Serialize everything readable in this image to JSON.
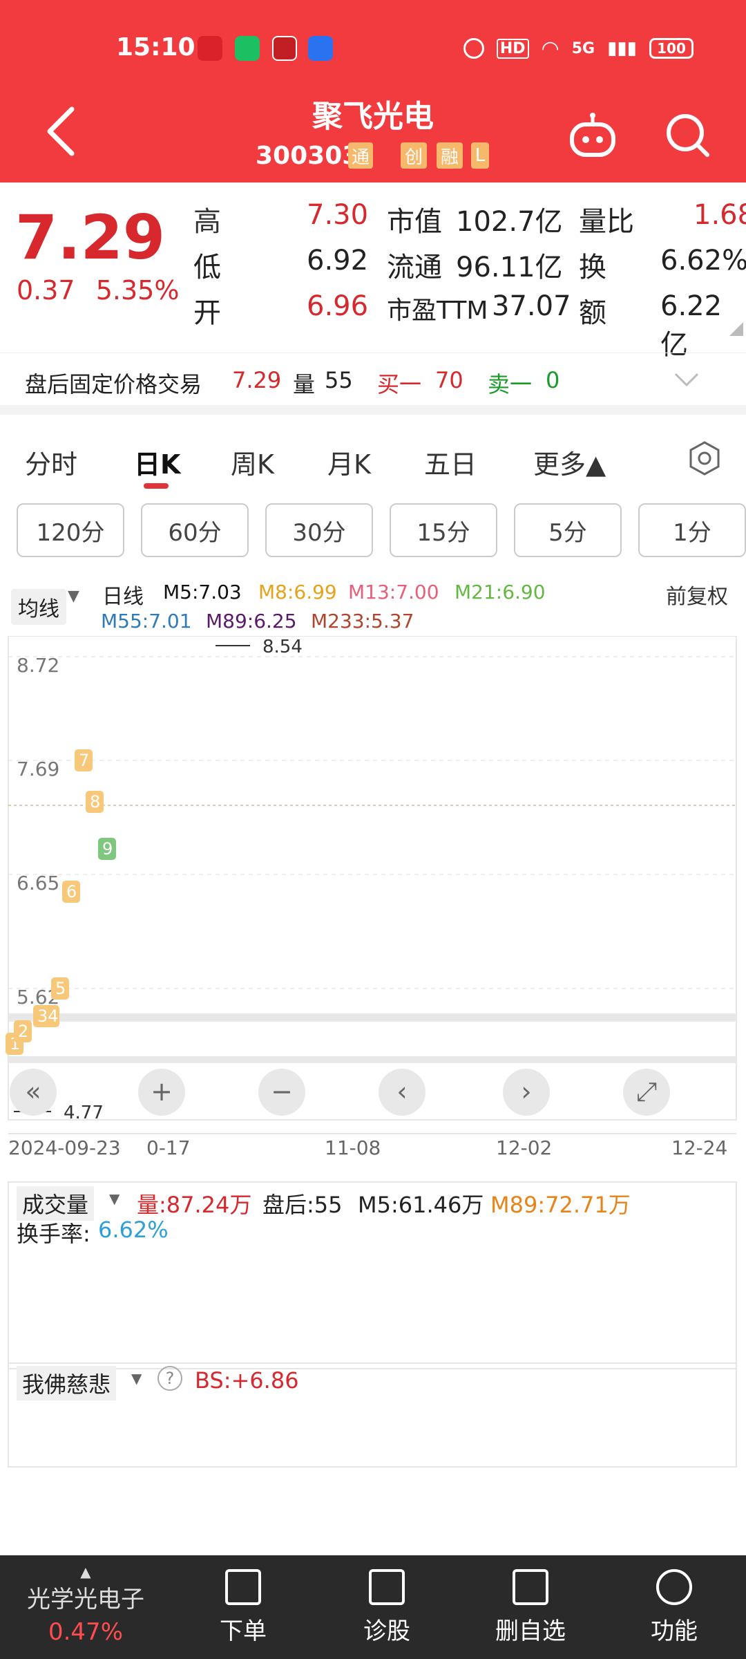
{
  "status_bar": {
    "time": "15:10",
    "network": "5G",
    "hd": "HD",
    "battery": "100"
  },
  "header": {
    "stock_name": "聚飞光电",
    "stock_code": "300303",
    "badges": [
      "通",
      "创",
      "融",
      "L"
    ]
  },
  "quote": {
    "price": "7.29",
    "change": "0.37",
    "change_pct": "5.35%",
    "rows": [
      {
        "l1": "高",
        "v1": "7.30",
        "l2": "市值",
        "v2": "102.7亿",
        "l3": "量比",
        "v3": "1.68"
      },
      {
        "l1": "低",
        "v1": "6.92",
        "l2": "流通",
        "v2": "96.11亿",
        "l3": "换",
        "v3": "6.62%"
      },
      {
        "l1": "开",
        "v1": "6.96",
        "l2": "市盈TTM",
        "v2": "37.07",
        "l3": "额",
        "v3": "6.22亿"
      }
    ]
  },
  "after_hours": {
    "label": "盘后固定价格交易",
    "price": "7.29",
    "vol_label": "量",
    "vol": "55",
    "buy_label": "买一",
    "buy": "70",
    "sell_label": "卖一",
    "sell": "0"
  },
  "tabs": [
    "分时",
    "日K",
    "周K",
    "月K",
    "五日",
    "更多▲"
  ],
  "periods": [
    "120分",
    "60分",
    "30分",
    "15分",
    "5分",
    "1分"
  ],
  "ma": {
    "selector": "均线",
    "type": "日线",
    "m5": "M5:7.03",
    "m8": "M8:6.99",
    "m13": "M13:7.00",
    "m21": "M21:6.90",
    "m55": "M55:7.01",
    "m89": "M89:6.25",
    "m233": "M233:5.37",
    "adjust": "前复权"
  },
  "chart_data": {
    "type": "candlestick",
    "y_ticks": [
      "8.72",
      "7.69",
      "6.65",
      "5.62"
    ],
    "high_mark": "8.54",
    "low_mark": "4.77",
    "x_ticks": [
      "2024-09-23",
      "0-17",
      "11-08",
      "12-02",
      "12-24"
    ],
    "signals": [
      "1",
      "2",
      "34",
      "5",
      "6",
      "7",
      "8",
      "9"
    ]
  },
  "volume": {
    "selector": "成交量",
    "vol": "量:87.24万",
    "after": "盘后:55",
    "m5": "M5:61.46万",
    "m89": "M89:72.71万",
    "turnover_label": "换手率:",
    "turnover": "6.62%"
  },
  "indicator": {
    "selector": "我佛慈悲",
    "bs": "BS:+6.86"
  },
  "bottom_bar": {
    "sector": "光学光电子",
    "sector_pct": "0.47%",
    "items": [
      "下单",
      "诊股",
      "删自选",
      "功能"
    ]
  },
  "colors": {
    "brand_red": "#f23b3f",
    "up": "#d7282e",
    "down": "#1a9b2a"
  }
}
